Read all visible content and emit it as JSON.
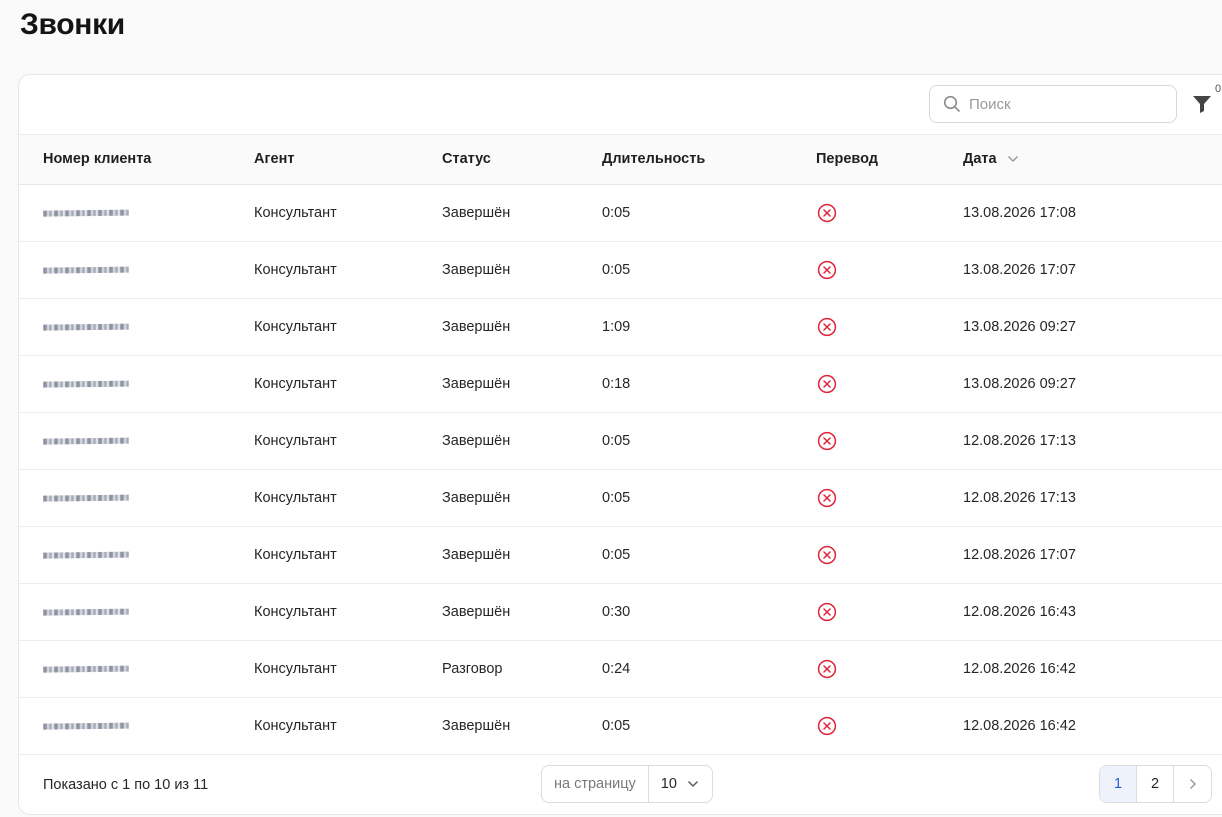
{
  "page": {
    "title": "Звонки"
  },
  "toolbar": {
    "search_placeholder": "Поиск",
    "filter_count": "0"
  },
  "table": {
    "columns": [
      "Номер клиента",
      "Агент",
      "Статус",
      "Длительность",
      "Перевод",
      "Дата"
    ],
    "sort_icon": "chevron-down-icon",
    "rows": [
      {
        "agent": "Консультант",
        "status": "Завершён",
        "duration": "0:05",
        "transfer": "x-circle-icon",
        "date": "13.08.2026 17:08"
      },
      {
        "agent": "Консультант",
        "status": "Завершён",
        "duration": "0:05",
        "transfer": "x-circle-icon",
        "date": "13.08.2026 17:07"
      },
      {
        "agent": "Консультант",
        "status": "Завершён",
        "duration": "1:09",
        "transfer": "x-circle-icon",
        "date": "13.08.2026 09:27"
      },
      {
        "agent": "Консультант",
        "status": "Завершён",
        "duration": "0:18",
        "transfer": "x-circle-icon",
        "date": "13.08.2026 09:27"
      },
      {
        "agent": "Консультант",
        "status": "Завершён",
        "duration": "0:05",
        "transfer": "x-circle-icon",
        "date": "12.08.2026 17:13"
      },
      {
        "agent": "Консультант",
        "status": "Завершён",
        "duration": "0:05",
        "transfer": "x-circle-icon",
        "date": "12.08.2026 17:13"
      },
      {
        "agent": "Консультант",
        "status": "Завершён",
        "duration": "0:05",
        "transfer": "x-circle-icon",
        "date": "12.08.2026 17:07"
      },
      {
        "agent": "Консультант",
        "status": "Завершён",
        "duration": "0:30",
        "transfer": "x-circle-icon",
        "date": "12.08.2026 16:43"
      },
      {
        "agent": "Консультант",
        "status": "Разговор",
        "duration": "0:24",
        "transfer": "x-circle-icon",
        "date": "12.08.2026 16:42"
      },
      {
        "agent": "Консультант",
        "status": "Завершён",
        "duration": "0:05",
        "transfer": "x-circle-icon",
        "date": "12.08.2026 16:42"
      }
    ]
  },
  "footer": {
    "showing": "Показано с 1 по 10 из 11",
    "per_page_label": "на страницу",
    "per_page_value": "10",
    "pages": [
      "1",
      "2"
    ],
    "active_page": "1"
  },
  "colors": {
    "transfer_no": "#e0243a",
    "active_page": "#2d5bd6"
  }
}
